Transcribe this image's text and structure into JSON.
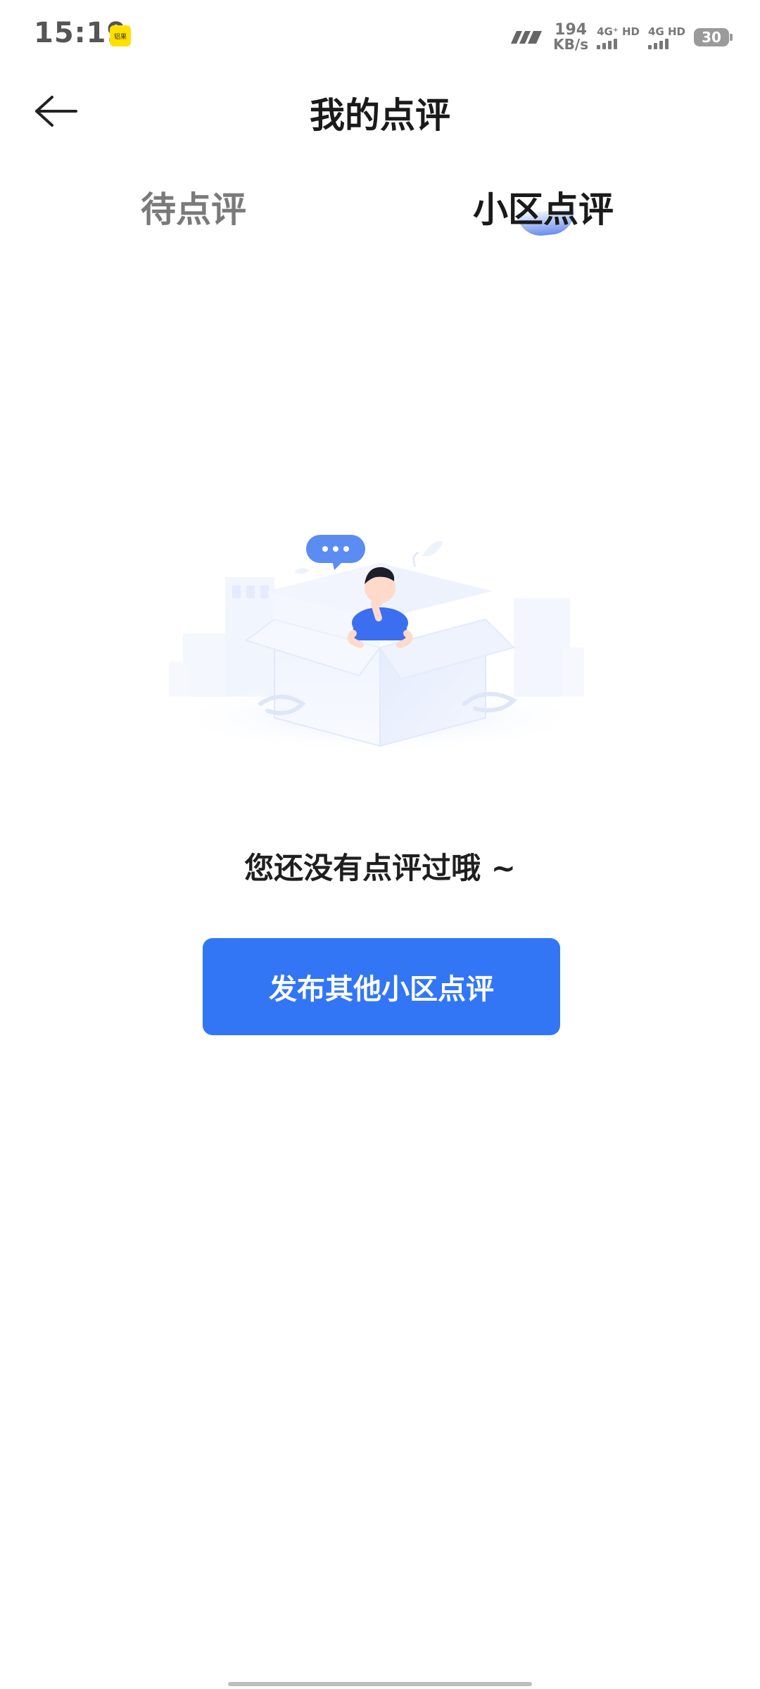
{
  "status_bar": {
    "time": "15:19",
    "notification_badge": "铝果",
    "net_speed_value": "194",
    "net_speed_unit": "KB/s",
    "sim1_label": "4G⁺ HD",
    "sim2_label": "4G HD",
    "battery": "30"
  },
  "header": {
    "title": "我的点评"
  },
  "tabs": [
    {
      "label": "待点评"
    },
    {
      "label": "小区点评"
    }
  ],
  "empty_state": {
    "message": "您还没有点评过哦 ~",
    "button_label": "发布其他小区点评"
  },
  "colors": {
    "accent": "#3276f5",
    "tab_inactive": "#7a7a7a",
    "text_primary": "#1f1f1f"
  },
  "icons": {
    "back": "arrow-left-icon",
    "illustration": "empty-box-illustration"
  }
}
